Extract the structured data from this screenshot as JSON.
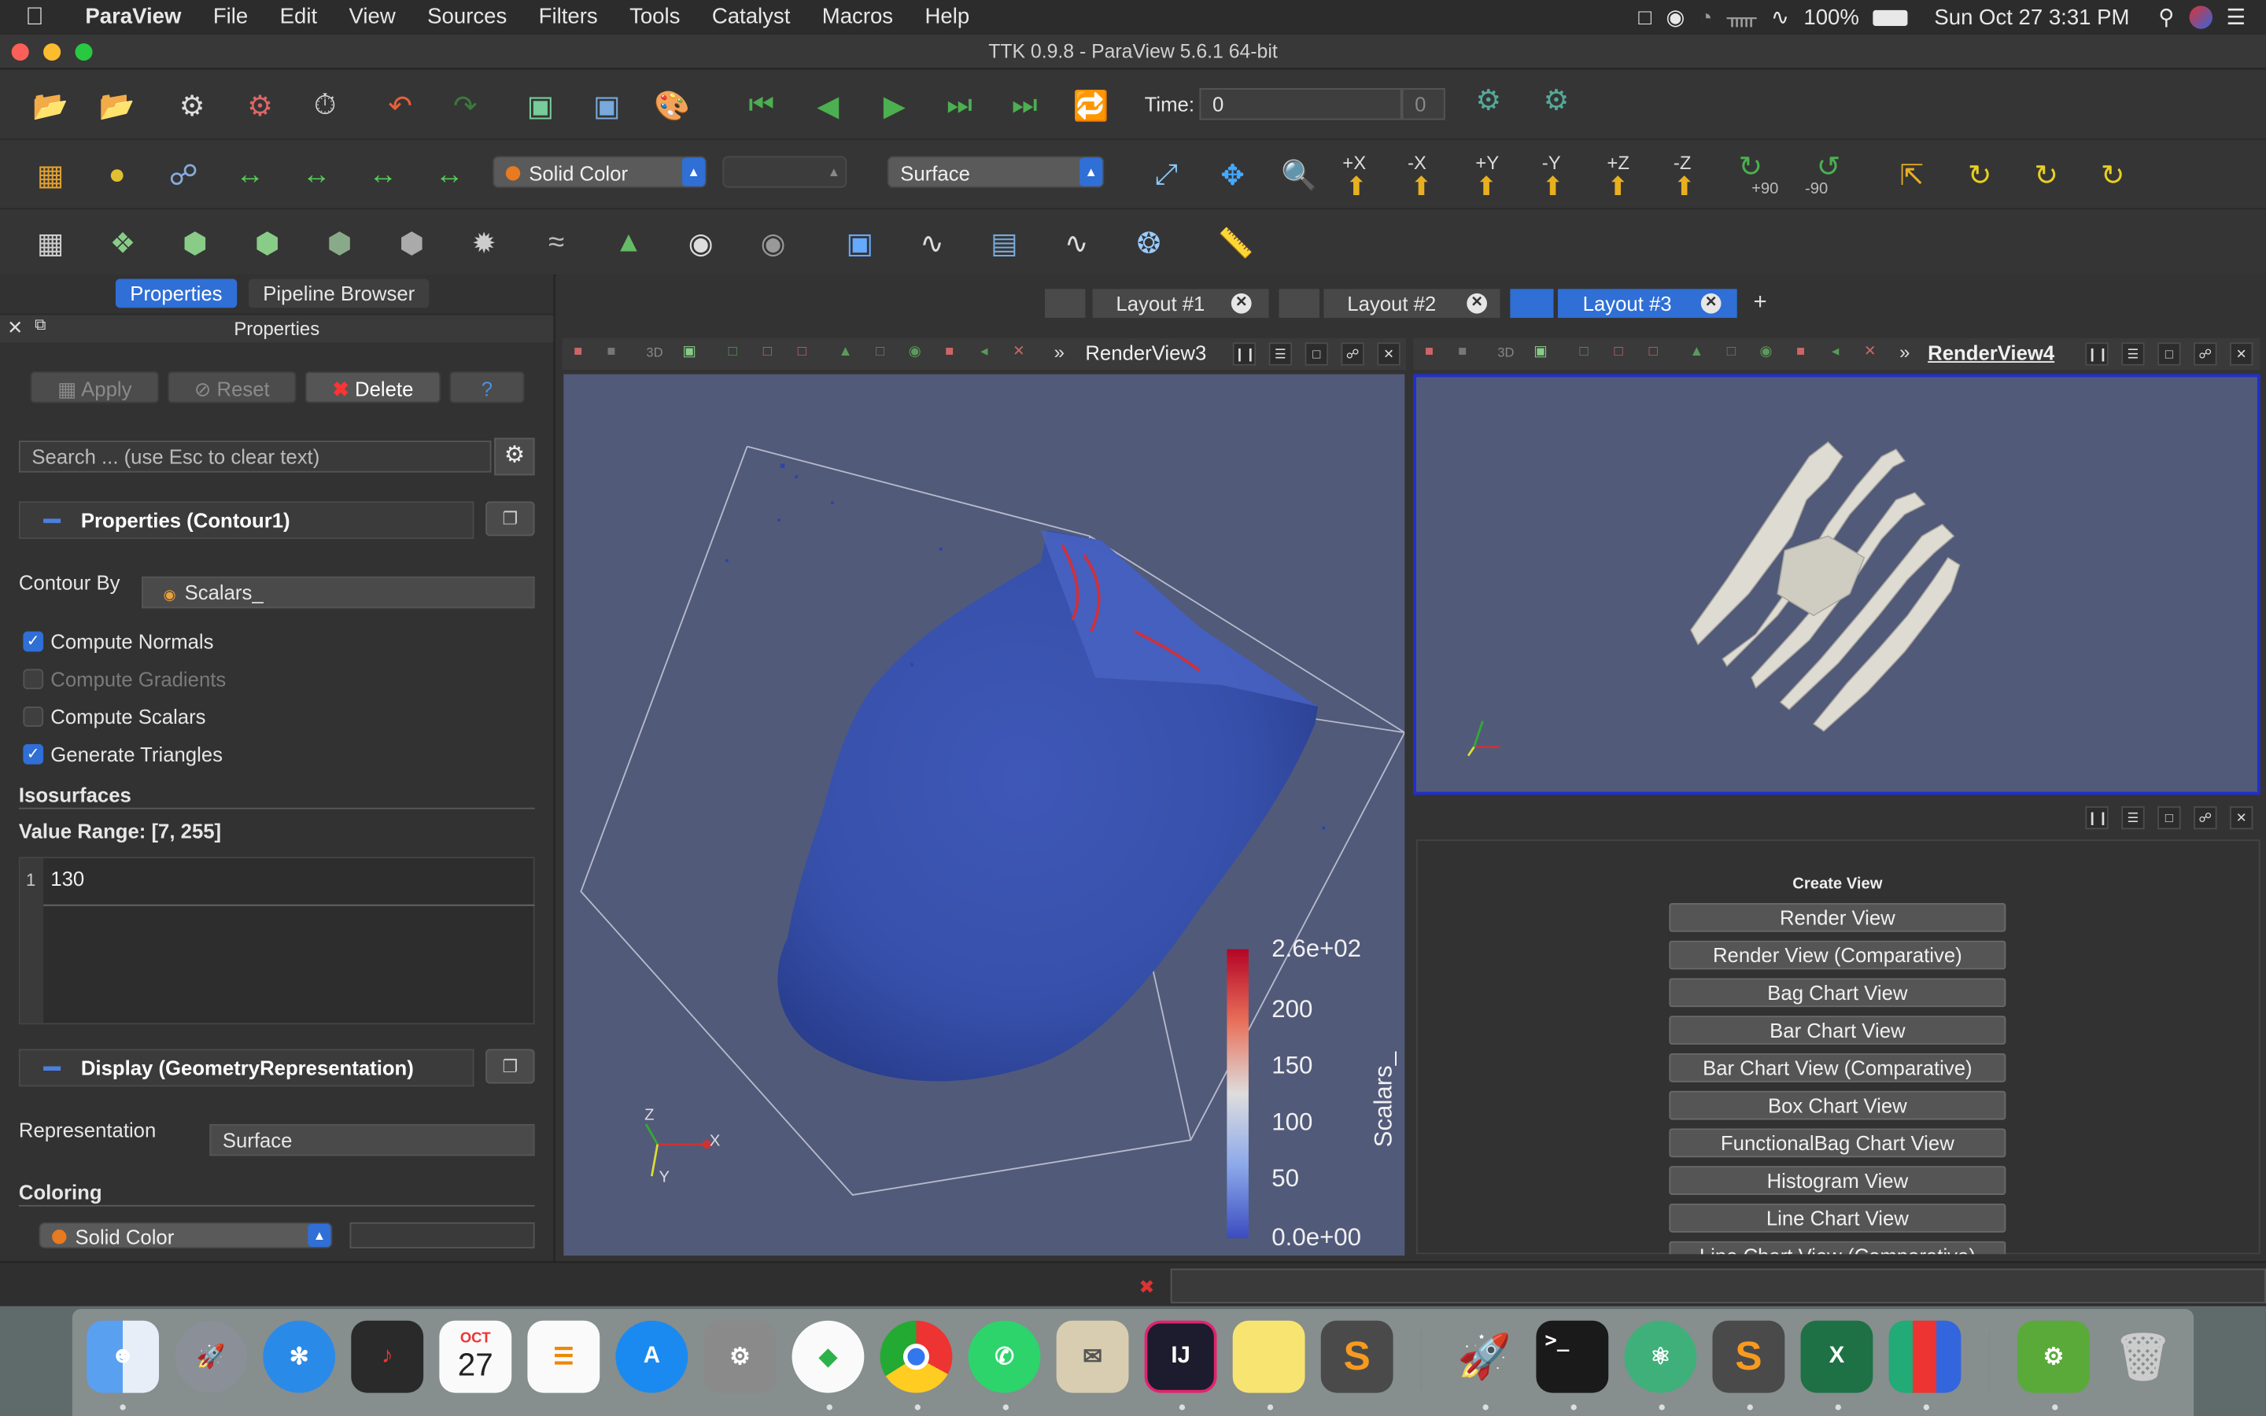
{
  "menubar": {
    "app_name": "ParaView",
    "items": [
      "File",
      "Edit",
      "View",
      "Sources",
      "Filters",
      "Tools",
      "Catalyst",
      "Macros",
      "Help"
    ],
    "battery": "100%",
    "datetime": "Sun Oct 27  3:31 PM"
  },
  "window": {
    "title": "TTK 0.9.8 - ParaView 5.6.1 64-bit"
  },
  "toolbar": {
    "time_label": "Time:",
    "time_value": "0",
    "time_index": "0",
    "color_combo": "Solid Color",
    "representation_combo": "Surface",
    "rotate_plus": "+90",
    "rotate_minus": "-90",
    "axis_labels": [
      "+X",
      "-X",
      "+Y",
      "-Y",
      "+Z",
      "-Z"
    ]
  },
  "left_panel": {
    "tabs": [
      "Properties",
      "Pipeline Browser"
    ],
    "header": "Properties",
    "buttons": {
      "apply": "Apply",
      "reset": "Reset",
      "delete": "Delete",
      "help": "?"
    },
    "search_placeholder": "Search ... (use Esc to clear text)",
    "properties_section": "Properties (Contour1)",
    "contour_by_label": "Contour By",
    "contour_by_value": "Scalars_",
    "checkboxes": [
      {
        "label": "Compute Normals",
        "checked": true
      },
      {
        "label": "Compute Gradients",
        "checked": false
      },
      {
        "label": "Compute Scalars",
        "checked": false
      },
      {
        "label": "Generate Triangles",
        "checked": true
      }
    ],
    "isosurfaces_label": "Isosurfaces",
    "value_range": "Value Range: [7, 255]",
    "iso_row_index": "1",
    "iso_value": "130",
    "display_section": "Display (GeometryRepresentation)",
    "representation_label": "Representation",
    "representation_value": "Surface",
    "coloring_label": "Coloring",
    "coloring_value": "Solid Color"
  },
  "layouts": {
    "tabs": [
      "Layout #1",
      "Layout #2",
      "Layout #3"
    ],
    "active": "Layout #3",
    "add": "+"
  },
  "views": {
    "left_title": "RenderView3",
    "right_title": "RenderView4",
    "axis_x": "X",
    "axis_y": "Y",
    "axis_z": "Z",
    "colorbar": {
      "title": "Scalars_",
      "ticks": [
        "2.6e+02",
        "200",
        "150",
        "100",
        "50",
        "0.0e+00"
      ]
    }
  },
  "create_view": {
    "title": "Create View",
    "buttons": [
      "Render View",
      "Render View (Comparative)",
      "Bag Chart View",
      "Bar Chart View",
      "Bar Chart View (Comparative)",
      "Box Chart View",
      "FunctionalBag Chart View",
      "Histogram View",
      "Line Chart View",
      "Line Chart View (Comparative)"
    ]
  },
  "dock": {
    "calendar_month": "OCT",
    "calendar_day": "27",
    "apps": [
      "Finder",
      "Launchpad",
      "Safari",
      "Voice Memos",
      "Calendar",
      "Reminders",
      "App Store",
      "System Preferences",
      "Evernote",
      "Chrome",
      "WhatsApp",
      "Mail",
      "IntelliJ IDEA",
      "Stickies",
      "Sublime Text",
      "Rocket",
      "Terminal",
      "Atom",
      "Sublime Text",
      "Excel",
      "Bar",
      "Android Studio",
      "Trash"
    ]
  },
  "colors": {
    "accent": "#2f6fd6",
    "view_bg": "#525a7a",
    "active_border": "#1f2fd0"
  }
}
